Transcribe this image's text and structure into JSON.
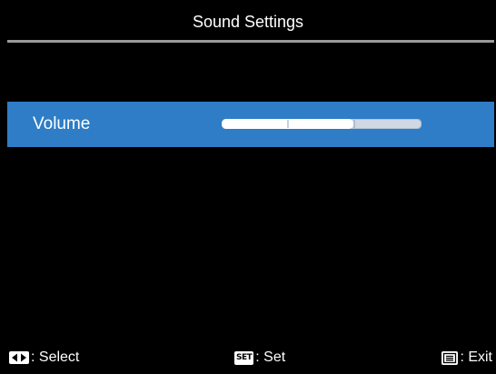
{
  "header": {
    "title": "Sound Settings"
  },
  "menu": {
    "items": [
      {
        "label": "Volume",
        "selected": true,
        "volume_level_fraction": 0.66
      }
    ]
  },
  "footer": {
    "select_icon": "left-right-arrows-icon",
    "select_label": ": Select",
    "set_icon_text": "SET",
    "set_label": ": Set",
    "exit_icon": "menu-list-icon",
    "exit_label": ": Exit"
  },
  "colors": {
    "background": "#000000",
    "selection_highlight": "#2e7dc6",
    "title_rule": "#9a9a9a",
    "bar_filled": "#ffffff",
    "bar_empty": "#cfd8e3"
  }
}
